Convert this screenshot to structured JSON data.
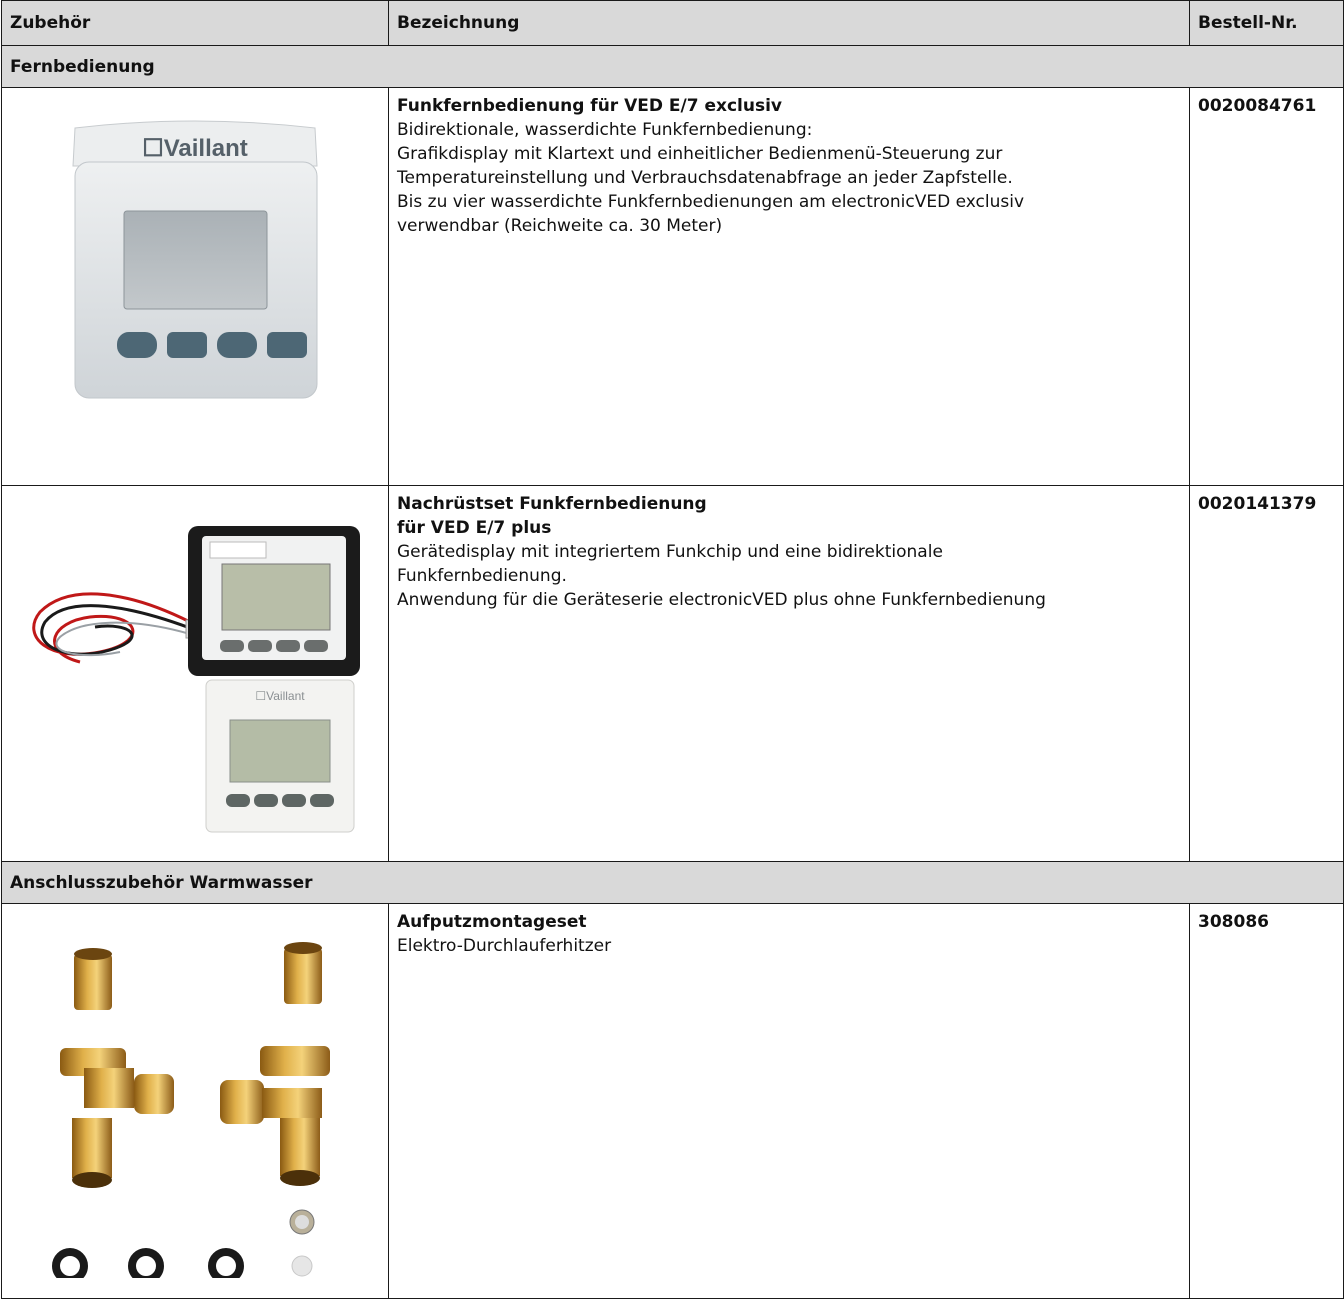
{
  "table": {
    "headers": {
      "col1": "Zubehör",
      "col2": "Bezeichnung",
      "col3": "Bestell-Nr."
    },
    "sections": [
      {
        "title": "Fernbedienung",
        "rows": [
          {
            "title_lines": [
              "Funkfernbedienung für VED E/7 exclusiv"
            ],
            "desc_lines": [
              "Bidirektionale, wasserdichte Funkfernbedienung:",
              "Grafikdisplay mit Klartext und einheitlicher Bedienmenü-Steuerung zur",
              "Temperatureinstellung und Verbrauchsdatenabfrage an jeder Zapfstelle.",
              "Bis zu vier wasserdichte Funkfernbedienungen am electronicVED exclusiv",
              "verwendbar (Reichweite ca. 30 Meter)"
            ],
            "order_no": "0020084761",
            "image": {
              "icon": "vaillant-remote-control-icon",
              "brand": "Vaillant"
            }
          },
          {
            "title_lines": [
              "Nachrüstset Funkfernbedienung",
              "für VED E/7 plus"
            ],
            "desc_lines": [
              "Gerätedisplay mit integriertem Funkchip und eine bidirektionale",
              "Funkfernbedienung.",
              "Anwendung für die Geräteserie electronicVED plus ohne Funkfernbedienung"
            ],
            "order_no": "0020141379",
            "image": {
              "icon": "retrofit-kit-icon",
              "brand": "Vaillant"
            }
          }
        ]
      },
      {
        "title": "Anschlusszubehör Warmwasser",
        "rows": [
          {
            "title_lines": [
              "Aufputzmontageset"
            ],
            "desc_lines": [
              "Elektro-Durchlauferhitzer"
            ],
            "order_no": "308086",
            "image": {
              "icon": "brass-fittings-icon"
            }
          }
        ]
      }
    ]
  }
}
